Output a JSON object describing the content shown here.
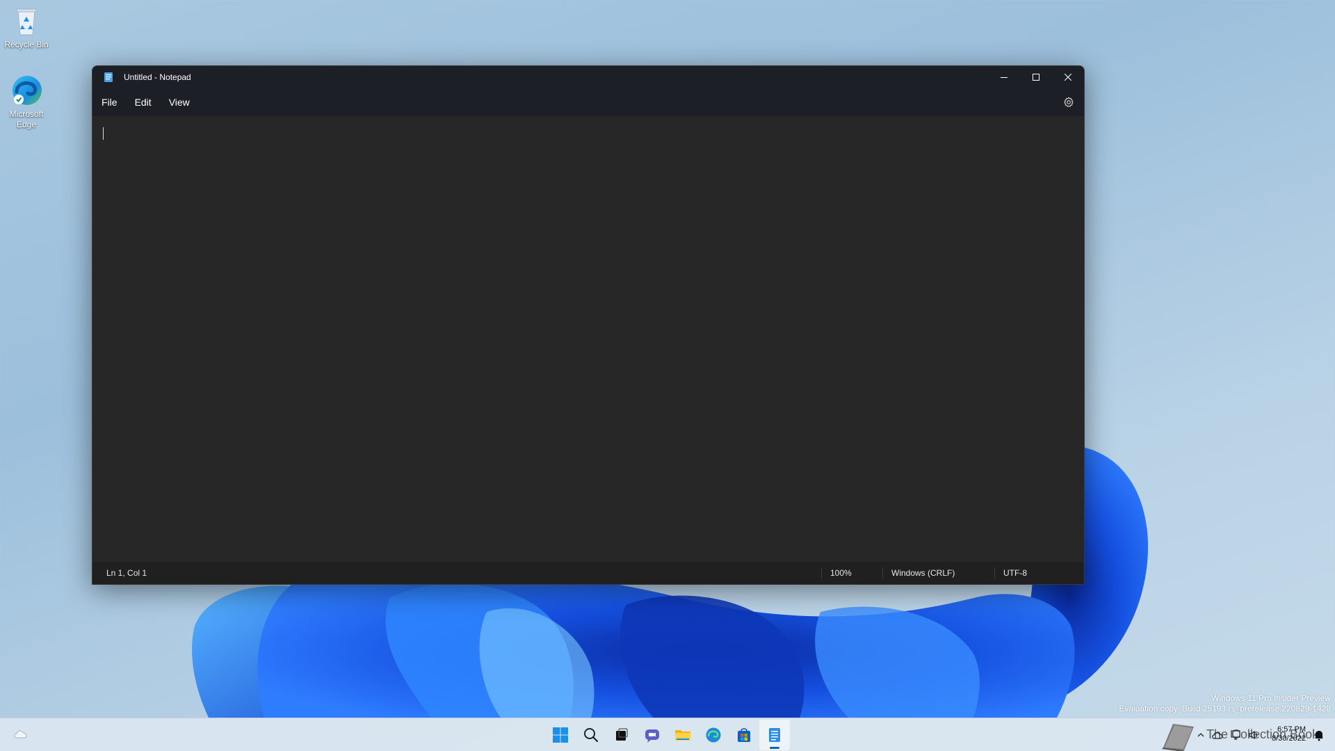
{
  "desktop": {
    "icons": [
      {
        "label": "Recycle Bin"
      },
      {
        "label": "Microsoft Edge"
      }
    ],
    "watermark": {
      "line1": "Windows 11 Pro Insider Preview",
      "line2": "Evaluation copy. Build 25193.rs_prerelease.220829-1428"
    }
  },
  "window": {
    "title": "Untitled - Notepad",
    "menu": [
      "File",
      "Edit",
      "View"
    ],
    "status": {
      "position": "Ln 1, Col 1",
      "zoom": "100%",
      "line_endings": "Windows (CRLF)",
      "encoding": "UTF-8"
    },
    "icons": {
      "app": "notepad-icon",
      "minimize": "minimize-icon",
      "maximize": "maximize-icon",
      "close": "close-icon",
      "settings": "gear-icon"
    }
  },
  "taskbar": {
    "apps": [
      "start-icon",
      "search-icon",
      "task-view-icon",
      "chat-icon",
      "file-explorer-icon",
      "edge-icon",
      "store-icon",
      "notepad-icon"
    ],
    "active_app": "notepad-icon",
    "tray": {
      "overlay_text": "The Collection Book",
      "time": "6:57 PM",
      "date": "8/30/2022"
    }
  },
  "colors": {
    "accent": "#0067c0",
    "titlebar": "#1c2026",
    "editor": "#272727"
  }
}
